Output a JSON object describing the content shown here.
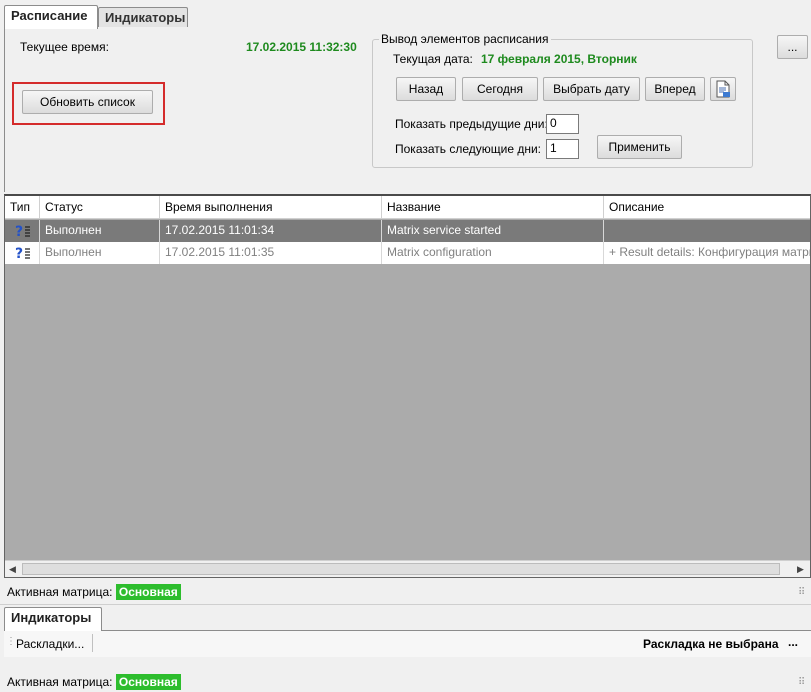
{
  "tabs": [
    {
      "label": "Расписание",
      "active": true
    },
    {
      "label": "Индикаторы",
      "active": false
    }
  ],
  "top": {
    "current_time_label": "Текущее время:",
    "current_time_value": "17.02.2015 11:32:30",
    "refresh_button": "Обновить список",
    "ellipsis_button": "..."
  },
  "schedule_group": {
    "legend": "Вывод элементов расписания",
    "current_date_label": "Текущая дата:",
    "current_date_value": "17 февраля 2015, Вторник",
    "buttons": {
      "back": "Назад",
      "today": "Сегодня",
      "pick_date": "Выбрать дату",
      "forward": "Вперед"
    },
    "prev_days_label": "Показать предыдущие дни:",
    "prev_days_value": "0",
    "next_days_label": "Показать следующие дни:",
    "next_days_value": "1",
    "apply_button": "Применить"
  },
  "grid": {
    "columns": [
      "Тип",
      "Статус",
      "Время выполнения",
      "Название",
      "Описание"
    ],
    "rows": [
      {
        "status": "Выполнен",
        "time": "17.02.2015 11:01:34",
        "name": "Matrix service started",
        "description": ""
      },
      {
        "status": "Выполнен",
        "time": "17.02.2015 11:01:35",
        "name": "Matrix configuration",
        "description": "+ Result details: Конфигурация матрицы ..."
      }
    ]
  },
  "status1": {
    "label": "Активная матрица:",
    "value": "Основная"
  },
  "indicators": {
    "tab": "Индикаторы",
    "layouts_button": "Раскладки...",
    "layout_status": "Раскладка не выбрана",
    "more": "..."
  },
  "status2": {
    "label": "Активная матрица:",
    "value": "Основная"
  },
  "colors": {
    "accent_green": "#1e8a1e",
    "badge_green": "#2dbd2d",
    "highlight_red": "#d42b2b"
  }
}
